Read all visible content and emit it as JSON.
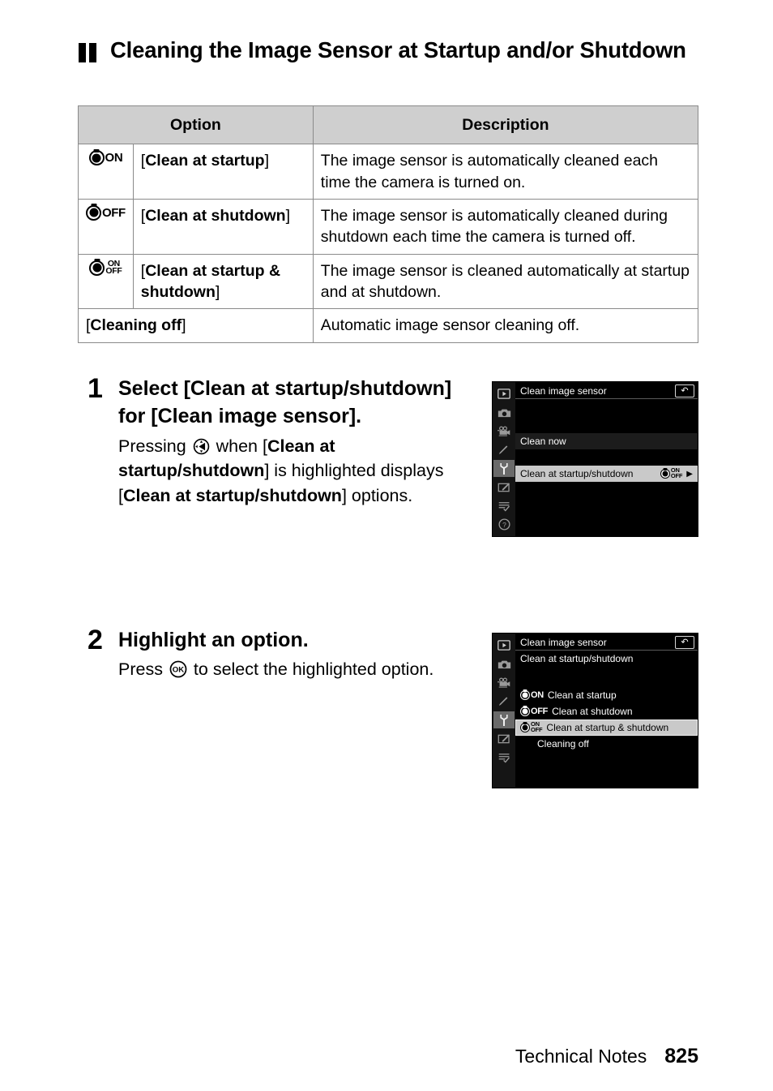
{
  "section": {
    "bullet_icon": "double-bar-bullet-icon",
    "title": "Cleaning the Image Sensor at Startup and/or Shutdown"
  },
  "table": {
    "headers": [
      "Option",
      "Description"
    ],
    "rows": [
      {
        "icon": "shutter-on-icon",
        "icon_label": "ON",
        "option_open": "[",
        "option": "Clean at startup",
        "option_close": "]",
        "description": "The image sensor is automatically cleaned each time the camera is turned on."
      },
      {
        "icon": "shutter-off-icon",
        "icon_label": "OFF",
        "option_open": "[",
        "option": "Clean at shutdown",
        "option_close": "]",
        "description": "The image sensor is automatically cleaned during shutdown each time the camera is turned off."
      },
      {
        "icon": "shutter-on-off-icon",
        "icon_label_top": "ON",
        "icon_label_bottom": "OFF",
        "option_open": "[",
        "option": "Clean at startup & shutdown",
        "option_close": "]",
        "description": "The image sensor is cleaned automatically at startup and at shutdown."
      },
      {
        "icon": null,
        "option_open": "[",
        "option": "Cleaning off",
        "option_close": "]",
        "description": "Automatic image sensor cleaning off."
      }
    ]
  },
  "steps": [
    {
      "number": "1",
      "title_parts": [
        "Select ",
        "[Clean at startup/shutdown]",
        " for ",
        "[Clean image sensor]",
        "."
      ],
      "body_parts": [
        "Pressing ",
        "multi-selector-right-icon",
        " when [",
        "Clean at startup/shutdown",
        "] is highlighted displays [",
        "Clean at startup/shutdown",
        "] options."
      ]
    },
    {
      "number": "2",
      "title_parts": [
        "Highlight an option."
      ],
      "body_parts": [
        "Press ",
        "ok-button-icon",
        " to select the highlighted option."
      ]
    }
  ],
  "lcd_screens": [
    {
      "name": "clean-image-sensor-menu",
      "title": "Clean image sensor",
      "back_icon": "back-arrow-icon",
      "rail_icons": [
        "playback-icon",
        "photo-shooting-icon",
        "movie-shooting-icon",
        "custom-settings-pencil-icon",
        "setup-wrench-icon",
        "retouch-icon",
        "my-menu-icon",
        "help-question-icon"
      ],
      "rail_active_index": 4,
      "subtitle": "",
      "rows": [
        {
          "label": "Clean now",
          "style": "dark",
          "value": "",
          "caret": ""
        },
        {
          "label": "Clean at startup/shutdown",
          "style": "highlight",
          "value_icon": "shutter-on-off-icon",
          "value_top": "ON",
          "value_bottom": "OFF",
          "caret": "▶"
        }
      ]
    },
    {
      "name": "clean-at-startup-shutdown-menu",
      "title": "Clean image sensor",
      "back_icon": "back-arrow-icon",
      "rail_icons": [
        "playback-icon",
        "photo-shooting-icon",
        "movie-shooting-icon",
        "custom-settings-pencil-icon",
        "setup-wrench-icon",
        "retouch-icon",
        "my-menu-icon"
      ],
      "rail_active_index": 4,
      "subtitle": "Clean at startup/shutdown",
      "rows": [
        {
          "label": "Clean at startup",
          "style": "plain",
          "icon": "shutter-on-icon",
          "icon_label": "ON"
        },
        {
          "label": "Clean at shutdown",
          "style": "plain",
          "icon": "shutter-off-icon",
          "icon_label": "OFF"
        },
        {
          "label": "Clean at startup & shutdown",
          "style": "selected",
          "icon": "shutter-on-off-icon",
          "icon_top": "ON",
          "icon_bottom": "OFF"
        },
        {
          "label": "Cleaning off",
          "style": "plain-indent"
        }
      ]
    }
  ],
  "footer": {
    "label": "Technical Notes",
    "page": "825"
  },
  "colors": {
    "table_header_bg": "#cfcfcf",
    "table_border": "#8a8a8a",
    "lcd_bg": "#000000",
    "lcd_rail_bg": "#151515",
    "lcd_highlight_bg": "#c9c9c9",
    "lcd_active_rail": "#6a6a6a"
  }
}
